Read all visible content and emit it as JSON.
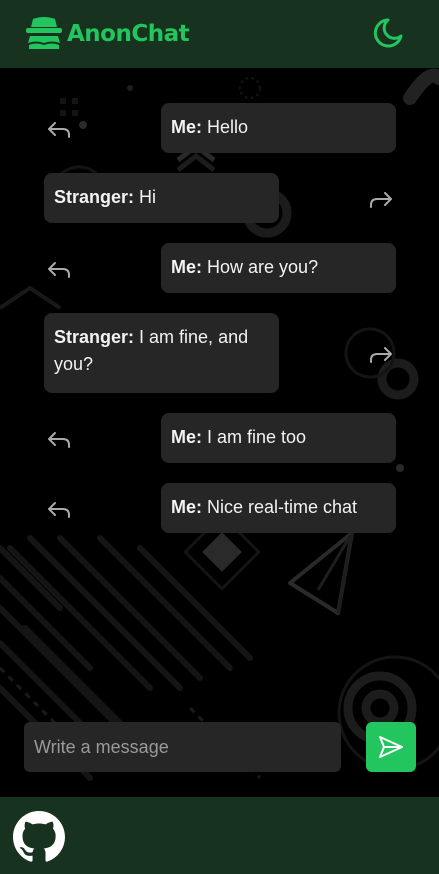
{
  "app": {
    "name": "AnonChat",
    "brand_color": "#22c55e",
    "header_bg": "#17321f"
  },
  "header": {
    "logo_icon": "incognito-icon",
    "theme_toggle_icon": "moon-icon"
  },
  "messages": [
    {
      "sender": "Me:",
      "text": "Hello",
      "side": "right"
    },
    {
      "sender": "Stranger:",
      "text": "Hi",
      "side": "left"
    },
    {
      "sender": "Me:",
      "text": "How are you?",
      "side": "right"
    },
    {
      "sender": "Stranger:",
      "text": "I am fine, and you?",
      "side": "left"
    },
    {
      "sender": "Me:",
      "text": "I am fine too",
      "side": "right"
    },
    {
      "sender": "Me:",
      "text": "Nice real-time chat",
      "side": "right"
    }
  ],
  "composer": {
    "placeholder": "Write a message",
    "value": "",
    "send_icon": "send-icon"
  },
  "footer": {
    "github_icon": "github-icon"
  }
}
